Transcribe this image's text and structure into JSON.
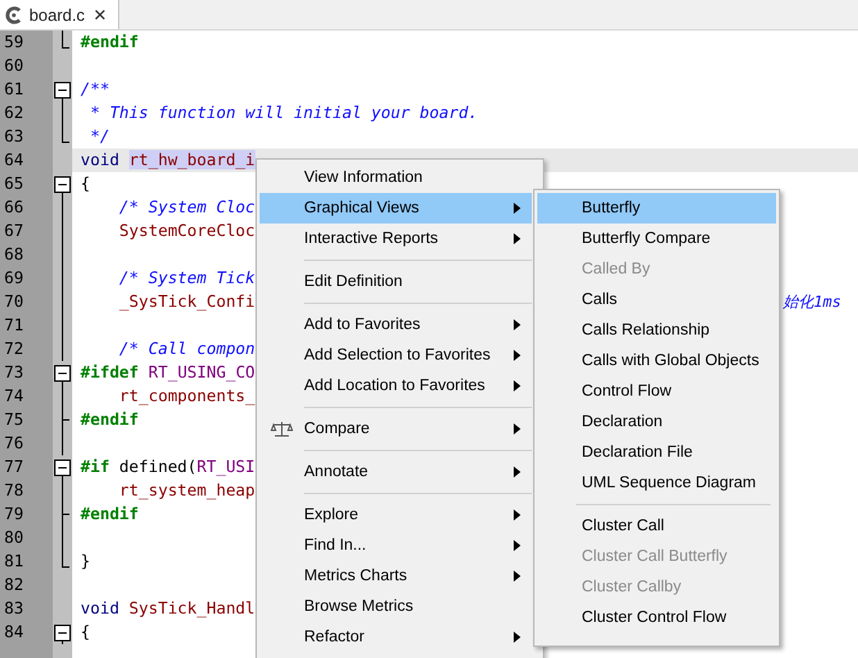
{
  "tab": {
    "label": "board.c",
    "close": "✕"
  },
  "code_lines": [
    {
      "number": "59",
      "kind": "fold-end",
      "current": false,
      "tokens": [
        {
          "text": "#endif",
          "kind": "pre"
        }
      ]
    },
    {
      "number": "60",
      "kind": "plain",
      "current": false
    },
    {
      "number": "61",
      "kind": "fold-start",
      "current": false,
      "tokens": [
        {
          "text": "/**",
          "kind": "comment"
        }
      ]
    },
    {
      "number": "62",
      "kind": "fold-line",
      "current": false,
      "tokens": [
        {
          "text": " * This function will initial your board.",
          "kind": "comment"
        }
      ]
    },
    {
      "number": "63",
      "kind": "fold-end",
      "current": false,
      "tokens": [
        {
          "text": " */",
          "kind": "comment"
        }
      ]
    },
    {
      "number": "64",
      "kind": "plain",
      "current": true,
      "tokens": [
        {
          "text": "void ",
          "kind": "keyword"
        },
        {
          "text": "rt_hw_board_i",
          "kind": "match"
        }
      ]
    },
    {
      "number": "65",
      "kind": "fold-start",
      "current": false,
      "tokens": [
        {
          "text": "{",
          "kind": "plain"
        }
      ]
    },
    {
      "number": "66",
      "kind": "fold-line",
      "current": false,
      "tokens": [
        {
          "text": "    /* System Cloc",
          "kind": "comment"
        }
      ]
    },
    {
      "number": "67",
      "kind": "fold-line",
      "current": false,
      "tokens": [
        {
          "text": "    SystemCoreCloc",
          "kind": "ident"
        }
      ]
    },
    {
      "number": "68",
      "kind": "fold-line",
      "current": false
    },
    {
      "number": "69",
      "kind": "fold-line",
      "current": false,
      "tokens": [
        {
          "text": "    /* System Tick",
          "kind": "comment"
        }
      ]
    },
    {
      "number": "70",
      "kind": "fold-line",
      "current": false,
      "tokens": [
        {
          "text": "    _SysTick_Confi",
          "kind": "ident"
        }
      ],
      "tail": "始化1ms"
    },
    {
      "number": "71",
      "kind": "fold-line",
      "current": false
    },
    {
      "number": "72",
      "kind": "fold-line",
      "current": false,
      "tokens": [
        {
          "text": "    /* Call compon",
          "kind": "comment"
        }
      ]
    },
    {
      "number": "73",
      "kind": "fold-start",
      "current": false,
      "tokens": [
        {
          "text": "#ifdef ",
          "kind": "pre"
        },
        {
          "text": "RT_USING_CO",
          "kind": "macro"
        }
      ]
    },
    {
      "number": "74",
      "kind": "fold-line",
      "current": false,
      "tokens": [
        {
          "text": "    rt_components_",
          "kind": "ident"
        }
      ]
    },
    {
      "number": "75",
      "kind": "fold-branch",
      "current": false,
      "tokens": [
        {
          "text": "#endif",
          "kind": "pre"
        }
      ]
    },
    {
      "number": "76",
      "kind": "fold-line",
      "current": false
    },
    {
      "number": "77",
      "kind": "fold-start",
      "current": false,
      "tokens": [
        {
          "text": "#if ",
          "kind": "pre"
        },
        {
          "text": "defined(",
          "kind": "plain"
        },
        {
          "text": "RT_USI",
          "kind": "macro"
        }
      ]
    },
    {
      "number": "78",
      "kind": "fold-line",
      "current": false,
      "tokens": [
        {
          "text": "    rt_system_heap",
          "kind": "ident"
        }
      ]
    },
    {
      "number": "79",
      "kind": "fold-branch",
      "current": false,
      "tokens": [
        {
          "text": "#endif",
          "kind": "pre"
        }
      ]
    },
    {
      "number": "80",
      "kind": "fold-line",
      "current": false
    },
    {
      "number": "81",
      "kind": "fold-end",
      "current": false,
      "tokens": [
        {
          "text": "}",
          "kind": "plain"
        }
      ]
    },
    {
      "number": "82",
      "kind": "plain",
      "current": false
    },
    {
      "number": "83",
      "kind": "plain",
      "current": false,
      "tokens": [
        {
          "text": "void ",
          "kind": "keyword"
        },
        {
          "text": "SysTick_Handl",
          "kind": "ident"
        }
      ]
    },
    {
      "number": "84",
      "kind": "fold-start",
      "current": false,
      "tokens": [
        {
          "text": "{",
          "kind": "plain"
        }
      ]
    }
  ],
  "context_menu": [
    {
      "kind": "item",
      "label": "View Information",
      "selected": false,
      "submenu": false
    },
    {
      "kind": "item",
      "label": "Graphical Views",
      "selected": true,
      "submenu": true
    },
    {
      "kind": "item",
      "label": "Interactive Reports",
      "selected": false,
      "submenu": true
    },
    {
      "kind": "separator"
    },
    {
      "kind": "item",
      "label": "Edit Definition",
      "selected": false,
      "submenu": false
    },
    {
      "kind": "separator"
    },
    {
      "kind": "item",
      "label": "Add to Favorites",
      "selected": false,
      "submenu": true
    },
    {
      "kind": "item",
      "label": "Add Selection to Favorites",
      "selected": false,
      "submenu": true
    },
    {
      "kind": "item",
      "label": "Add Location to Favorites",
      "selected": false,
      "submenu": true
    },
    {
      "kind": "separator"
    },
    {
      "kind": "icon-item",
      "label": "Compare",
      "selected": false,
      "submenu": true
    },
    {
      "kind": "separator"
    },
    {
      "kind": "item",
      "label": "Annotate",
      "selected": false,
      "submenu": true
    },
    {
      "kind": "separator"
    },
    {
      "kind": "item",
      "label": "Explore",
      "selected": false,
      "submenu": true
    },
    {
      "kind": "item",
      "label": "Find In...",
      "selected": false,
      "submenu": true
    },
    {
      "kind": "item",
      "label": "Metrics Charts",
      "selected": false,
      "submenu": true
    },
    {
      "kind": "item",
      "label": "Browse Metrics",
      "selected": false,
      "submenu": false
    },
    {
      "kind": "item",
      "label": "Refactor",
      "selected": false,
      "submenu": true
    }
  ],
  "submenu": [
    {
      "kind": "item",
      "label": "Butterfly",
      "selected": true,
      "disabled": false
    },
    {
      "kind": "item",
      "label": "Butterfly Compare",
      "selected": false,
      "disabled": false
    },
    {
      "kind": "item",
      "label": "Called By",
      "selected": false,
      "disabled": true
    },
    {
      "kind": "item",
      "label": "Calls",
      "selected": false,
      "disabled": false
    },
    {
      "kind": "item",
      "label": "Calls Relationship",
      "selected": false,
      "disabled": false
    },
    {
      "kind": "item",
      "label": "Calls with Global Objects",
      "selected": false,
      "disabled": false
    },
    {
      "kind": "item",
      "label": "Control Flow",
      "selected": false,
      "disabled": false
    },
    {
      "kind": "item",
      "label": "Declaration",
      "selected": false,
      "disabled": false
    },
    {
      "kind": "item",
      "label": "Declaration File",
      "selected": false,
      "disabled": false
    },
    {
      "kind": "item",
      "label": "UML Sequence Diagram",
      "selected": false,
      "disabled": false
    },
    {
      "kind": "separator"
    },
    {
      "kind": "item",
      "label": "Cluster Call",
      "selected": false,
      "disabled": false
    },
    {
      "kind": "item",
      "label": "Cluster Call Butterfly",
      "selected": false,
      "disabled": true
    },
    {
      "kind": "item",
      "label": "Cluster Callby",
      "selected": false,
      "disabled": true
    },
    {
      "kind": "item",
      "label": "Cluster Control Flow",
      "selected": false,
      "disabled": false
    }
  ]
}
